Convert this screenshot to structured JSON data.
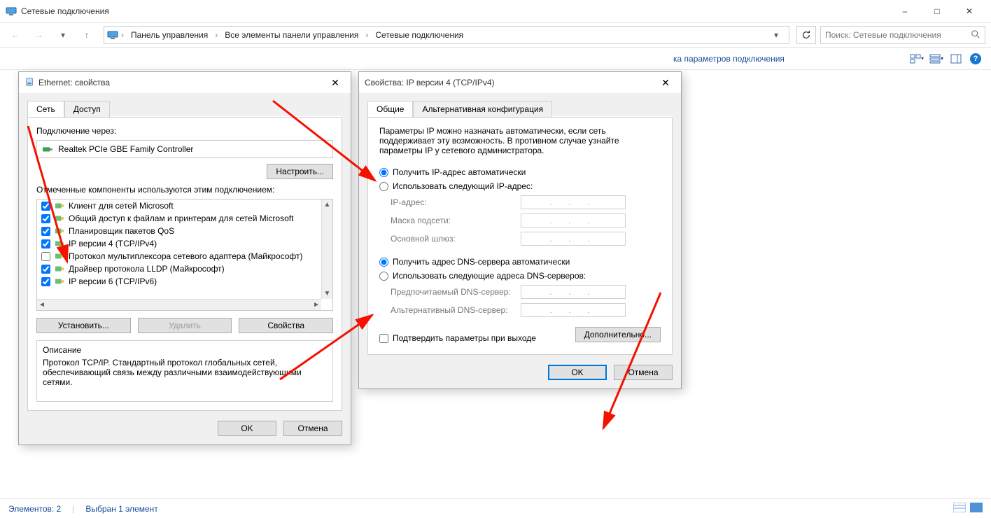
{
  "explorer": {
    "title": "Сетевые подключения",
    "breadcrumbs": [
      "Панель управления",
      "Все элементы панели управления",
      "Сетевые подключения"
    ],
    "search_placeholder": "Поиск: Сетевые подключения",
    "cmdbar_link": "ка параметров подключения",
    "status_items": "Элементов: 2",
    "status_selected": "Выбран 1 элемент"
  },
  "dlg1": {
    "title": "Ethernet: свойства",
    "tabs": {
      "network": "Сеть",
      "access": "Доступ"
    },
    "connect_via_label": "Подключение через:",
    "nic": "Realtek PCIe GBE Family Controller",
    "configure_btn": "Настроить...",
    "components_label": "Отмеченные компоненты используются этим подключением:",
    "components": [
      {
        "checked": true,
        "label": "Клиент для сетей Microsoft"
      },
      {
        "checked": true,
        "label": "Общий доступ к файлам и принтерам для сетей Microsoft"
      },
      {
        "checked": true,
        "label": "Планировщик пакетов QoS"
      },
      {
        "checked": true,
        "label": "IP версии 4 (TCP/IPv4)"
      },
      {
        "checked": false,
        "label": "Протокол мультиплексора сетевого адаптера (Майкрософт)"
      },
      {
        "checked": true,
        "label": "Драйвер протокола LLDP (Майкрософт)"
      },
      {
        "checked": true,
        "label": "IP версии 6 (TCP/IPv6)"
      }
    ],
    "install_btn": "Установить...",
    "remove_btn": "Удалить",
    "props_btn": "Свойства",
    "desc_heading": "Описание",
    "desc_text": "Протокол TCP/IP. Стандартный протокол глобальных сетей, обеспечивающий связь между различными взаимодействующими сетями.",
    "ok": "OK",
    "cancel": "Отмена"
  },
  "dlg2": {
    "title": "Свойства: IP версии 4 (TCP/IPv4)",
    "tabs": {
      "general": "Общие",
      "alt": "Альтернативная конфигурация"
    },
    "intro": "Параметры IP можно назначать автоматически, если сеть поддерживает эту возможность. В противном случае узнайте параметры IP у сетевого администратора.",
    "ip_auto": "Получить IP-адрес автоматически",
    "ip_manual": "Использовать следующий IP-адрес:",
    "ip_addr_k": "IP-адрес:",
    "mask_k": "Маска подсети:",
    "gw_k": "Основной шлюз:",
    "dns_auto": "Получить адрес DNS-сервера автоматически",
    "dns_manual": "Использовать следующие адреса DNS-серверов:",
    "dns_pref_k": "Предпочитаемый DNS-сервер:",
    "dns_alt_k": "Альтернативный DNS-сервер:",
    "validate": "Подтвердить параметры при выходе",
    "advanced": "Дополнительно...",
    "ok": "OK",
    "cancel": "Отмена",
    "ip_dots": ".  .  ."
  }
}
